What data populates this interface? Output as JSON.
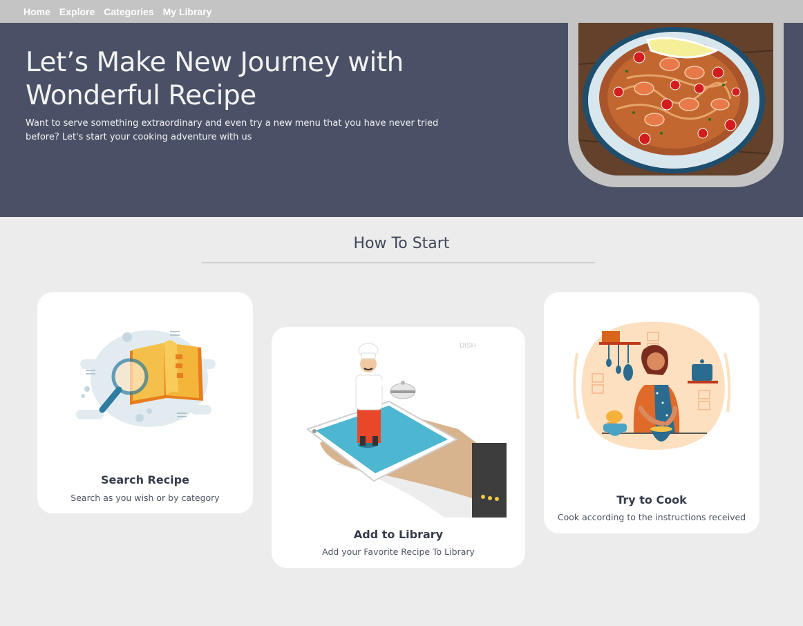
{
  "nav": {
    "items": [
      "Home",
      "Explore",
      "Categories",
      "My Library"
    ]
  },
  "hero": {
    "title_line1": "Let’s Make New Journey with",
    "title_line2": "Wonderful Recipe",
    "description": "Want to serve something extraordinary and even try a new menu that you have never tried before? Let's start your cooking adventure with us"
  },
  "how_to_start": {
    "heading": "How To Start",
    "steps": [
      {
        "title": "Search Recipe",
        "description": "Search as you wish or by category",
        "icon": "search-book-illustration"
      },
      {
        "title": "Add to Library",
        "description": "Add your Favorite Recipe To Library",
        "icon": "chef-phone-illustration",
        "image_text": "DISH"
      },
      {
        "title": "Try to Cook",
        "description": "Cook according to the instructions received",
        "icon": "woman-cooking-illustration"
      }
    ]
  },
  "colors": {
    "nav_bg": "#c4c4c4",
    "hero_bg": "#4a5166",
    "page_bg": "#ececec",
    "card_bg": "#ffffff",
    "heading_text": "#3f4658"
  }
}
